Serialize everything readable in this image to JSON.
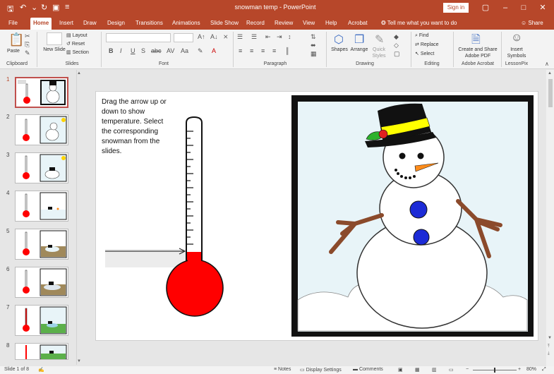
{
  "titlebar": {
    "title": "snowman temp - PowerPoint",
    "sign_in": "Sign in",
    "save_icon": "save-icon",
    "undo_icon": "undo-icon",
    "redo_icon": "redo-icon"
  },
  "tabs": [
    "File",
    "Home",
    "Insert",
    "Draw",
    "Design",
    "Transitions",
    "Animations",
    "Slide Show",
    "Record",
    "Review",
    "View",
    "Help",
    "Acrobat"
  ],
  "active_tab": "Home",
  "tell_me": "Tell me what you want to do",
  "share": "Share",
  "ribbon": {
    "clipboard": {
      "label": "Clipboard",
      "paste": "Paste"
    },
    "slides": {
      "label": "Slides",
      "new_slide": "New Slide",
      "layout": "Layout",
      "reset": "Reset",
      "section": "Section"
    },
    "font": {
      "label": "Font"
    },
    "paragraph": {
      "label": "Paragraph"
    },
    "drawing": {
      "label": "Drawing",
      "shapes": "Shapes",
      "arrange": "Arrange",
      "quick_styles": "Quick Styles"
    },
    "editing": {
      "label": "Editing",
      "find": "Find",
      "replace": "Replace",
      "select": "Select"
    },
    "adobe": {
      "label": "Adobe Acrobat",
      "create_share": "Create and Share Adobe PDF"
    },
    "lessonpix": {
      "label": "LessonPix",
      "insert_symbols": "Insert Symbols"
    }
  },
  "thumbnails": [
    "1",
    "2",
    "3",
    "4",
    "5",
    "6",
    "7",
    "8"
  ],
  "active_slide": 1,
  "slide": {
    "instructions": "Drag the arrow up or down to show temperature. Select the corresponding snowman from the slides."
  },
  "statusbar": {
    "slide_info": "Slide 1 of 8",
    "notes": "Notes",
    "display_settings": "Display Settings",
    "comments": "Comments",
    "zoom": "80%"
  },
  "colors": {
    "accent": "#b7472a",
    "thermo_red": "#ff0000",
    "snow_bg": "#e8f4f8",
    "hat": "#111111",
    "hat_band": "#ffff00",
    "buttons": "#1c2bd6",
    "arms": "#8b4a2b",
    "nose": "#ff8c1a"
  }
}
